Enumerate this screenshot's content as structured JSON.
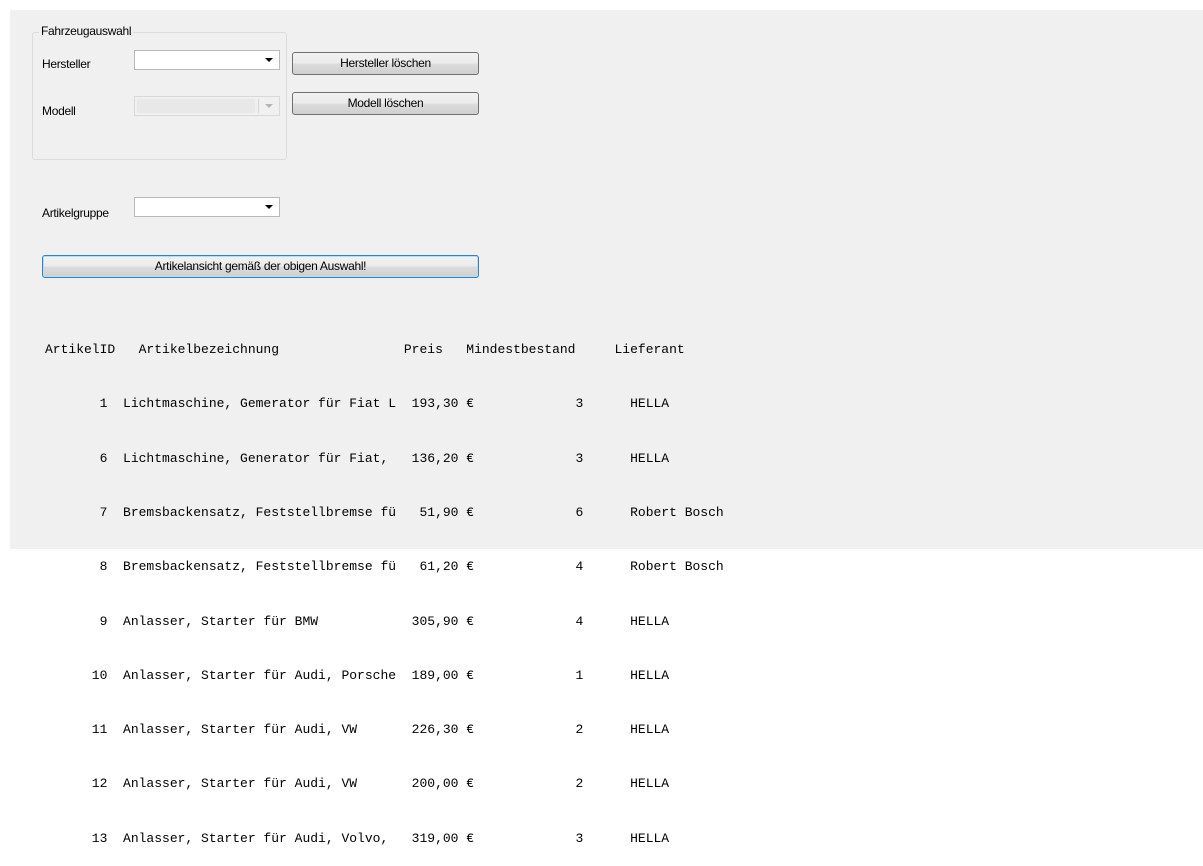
{
  "vehicle_group": {
    "title": "Fahrzeugauswahl",
    "manufacturer_label": "Hersteller",
    "manufacturer_value": "",
    "model_label": "Modell",
    "model_value": "",
    "clear_manufacturer_button": "Hersteller löschen",
    "clear_model_button": "Modell löschen"
  },
  "article_group": {
    "label": "Artikelgruppe",
    "value": ""
  },
  "show_button": "Artikelansicht gemäß der obigen Auswahl!",
  "article_list": {
    "header": "ArtikelID   Artikelbezeichnung                Preis   Mindestbestand     Lieferant",
    "rows": [
      "       1  Lichtmaschine, Gemerator für Fiat L  193,30 €             3      HELLA",
      "       6  Lichtmaschine, Generator für Fiat,   136,20 €             3      HELLA",
      "       7  Bremsbackensatz, Feststellbremse fü   51,90 €             6      Robert Bosch",
      "       8  Bremsbackensatz, Feststellbremse fü   61,20 €             4      Robert Bosch",
      "       9  Anlasser, Starter für BMW            305,90 €             4      HELLA",
      "      10  Anlasser, Starter für Audi, Porsche  189,00 €             1      HELLA",
      "      11  Anlasser, Starter für Audi, VW       226,30 €             2      HELLA",
      "      12  Anlasser, Starter für Audi, VW       200,00 €             2      HELLA",
      "      13  Anlasser, Starter für Audi, Volvo,   319,00 €             3      HELLA"
    ]
  }
}
